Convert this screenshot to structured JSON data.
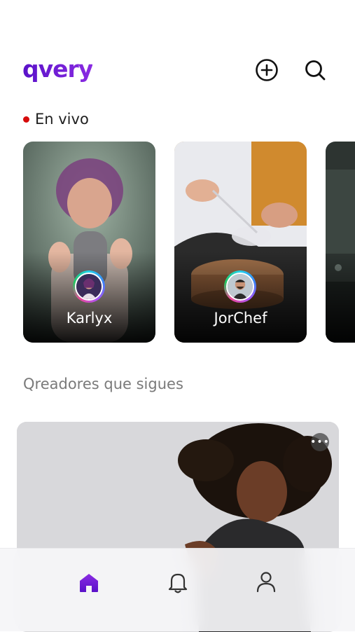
{
  "app": {
    "logo_text": "qvery",
    "brand_color": "#6d1fd6"
  },
  "header": {
    "actions": [
      {
        "icon": "plus-circle-icon"
      },
      {
        "icon": "search-icon"
      }
    ]
  },
  "live": {
    "title": "En vivo",
    "indicator_color": "#d60b0b",
    "cards": [
      {
        "name": "Karlyx",
        "avatar_icon": "avatar-karlyx",
        "thumbnail": "woman-with-microphone"
      },
      {
        "name": "JorChef",
        "avatar_icon": "avatar-jorchef",
        "thumbnail": "chef-plating-dish"
      },
      {
        "name": "",
        "thumbnail": "dark-night-scene"
      }
    ]
  },
  "following": {
    "title": "Qreadores que sigues",
    "post": {
      "thumbnail": "dancer-curly-hair",
      "more_label": "•••"
    }
  },
  "tabbar": {
    "items": [
      {
        "icon": "home-icon",
        "active": true
      },
      {
        "icon": "bell-icon",
        "active": false
      },
      {
        "icon": "user-icon",
        "active": false
      }
    ]
  }
}
